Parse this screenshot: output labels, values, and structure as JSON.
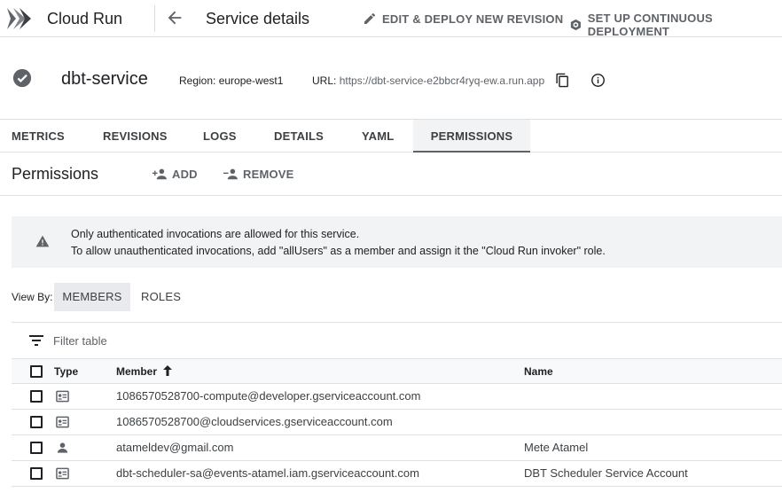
{
  "app": {
    "title": "Cloud Run"
  },
  "header": {
    "page_title": "Service details",
    "actions": [
      {
        "label": "EDIT & DEPLOY NEW REVISION",
        "icon": "pencil-icon"
      },
      {
        "label": "SET UP CONTINUOUS DEPLOYMENT",
        "icon": "deploy-icon"
      }
    ]
  },
  "service": {
    "name": "dbt-service",
    "status_icon": "check-circle-icon",
    "region": "Region: europe-west1",
    "url_label": "URL:",
    "url": "https://dbt-service-e2bbcr4ryq-ew.a.run.app"
  },
  "tabs": [
    {
      "label": "METRICS",
      "active": false
    },
    {
      "label": "REVISIONS",
      "active": false
    },
    {
      "label": "LOGS",
      "active": false
    },
    {
      "label": "DETAILS",
      "active": false
    },
    {
      "label": "YAML",
      "active": false
    },
    {
      "label": "PERMISSIONS",
      "active": true
    }
  ],
  "permissions": {
    "title": "Permissions",
    "add_label": "ADD",
    "remove_label": "REMOVE",
    "banner": {
      "line1": "Only authenticated invocations are allowed for this service.",
      "line2": "To allow unauthenticated invocations, add \"allUsers\" as a member and assign it the \"Cloud Run invoker\" role."
    },
    "view_by": {
      "label": "View By:",
      "options": [
        "MEMBERS",
        "ROLES"
      ],
      "selected": "MEMBERS"
    },
    "filter_placeholder": "Filter table",
    "columns": {
      "type": "Type",
      "member": "Member",
      "name": "Name"
    },
    "sort": {
      "column": "Member",
      "direction": "ascending"
    },
    "rows": [
      {
        "type": "service-account-icon",
        "member": "1086570528700-compute@developer.gserviceaccount.com",
        "name": ""
      },
      {
        "type": "service-account-icon",
        "member": "1086570528700@cloudservices.gserviceaccount.com",
        "name": ""
      },
      {
        "type": "person-icon",
        "member": "atameldev@gmail.com",
        "name": "Mete Atamel"
      },
      {
        "type": "service-account-icon",
        "member": "dbt-scheduler-sa@events-atamel.iam.gserviceaccount.com",
        "name": "DBT Scheduler Service Account"
      }
    ]
  },
  "colors": {
    "text_primary": "#202124",
    "text_secondary": "#5f6368",
    "banner_bg": "#f1f3f4",
    "active_tab_bg": "#f1f3f4",
    "divider": "#e0e0e0"
  }
}
